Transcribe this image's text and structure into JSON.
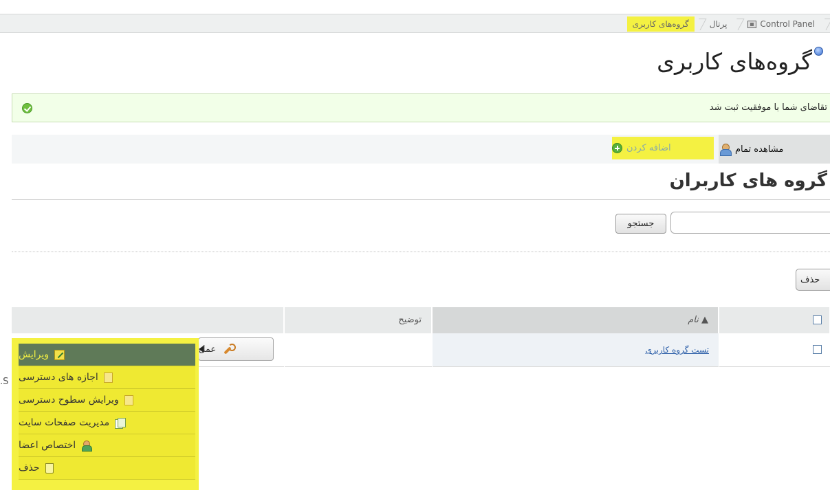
{
  "breadcrumb": {
    "items": [
      {
        "label": "Control Panel"
      },
      {
        "label": "پرتال"
      },
      {
        "label": "گروه‌های کاربری"
      }
    ]
  },
  "page": {
    "title": "گروه‌های کاربری",
    "success_message": "تقاضای شما با موفقیت ثبت شد"
  },
  "toolbar": {
    "view_all": "مشاهده تمام",
    "add": "اضافه کردن"
  },
  "section": {
    "title": "گروه های کاربران"
  },
  "search": {
    "button": "جستجو",
    "value": ""
  },
  "actions": {
    "delete": "حذف"
  },
  "table": {
    "columns": {
      "name": "▲ نام",
      "description": "توضیح"
    },
    "rows": [
      {
        "name": "تست گروه کاربری",
        "description": "",
        "action": "عمل"
      }
    ]
  },
  "menu": {
    "items": [
      {
        "label": "ویرایش",
        "icon": "edit-icon"
      },
      {
        "label": "اجازه های دسترسی",
        "icon": "permissions-icon"
      },
      {
        "label": "ویرایش سطوح دسترسی",
        "icon": "access-levels-icon"
      },
      {
        "label": "مدیریت صفحات سایت",
        "icon": "pages-icon"
      },
      {
        "label": "اختصاص اعضا",
        "icon": "assign-members-icon"
      },
      {
        "label": "حذف",
        "icon": "trash-icon"
      }
    ]
  },
  "stray_text": ".S"
}
